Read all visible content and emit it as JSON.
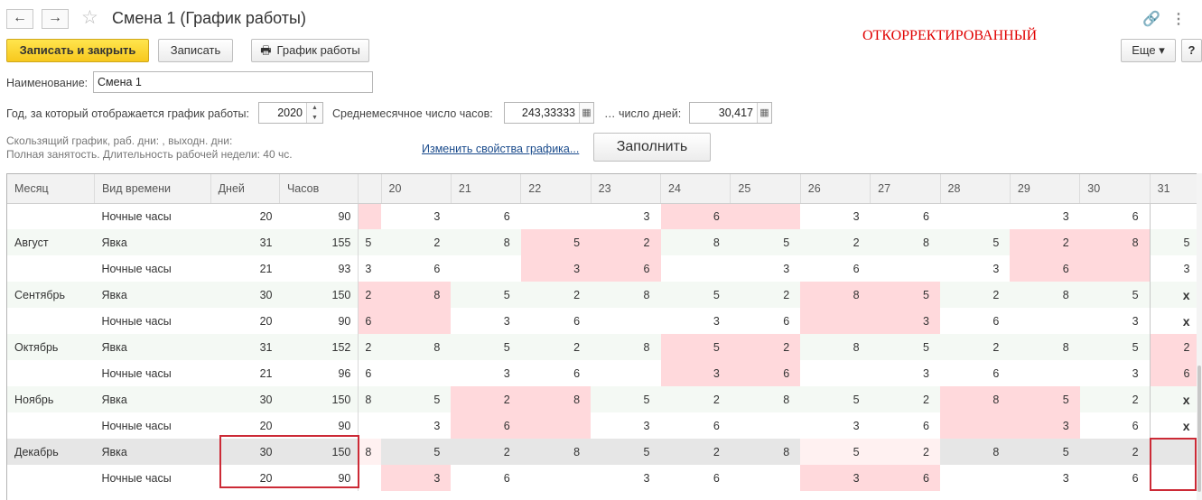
{
  "window": {
    "title": "Смена 1 (График работы)",
    "corrected_label": "ОТКОРРЕКТИРОВАННЫЙ",
    "back_icon": "←",
    "forward_icon": "→",
    "star_icon": "☆",
    "link_icon": "🔗",
    "more_icon": "⋮"
  },
  "toolbar": {
    "save_close_label": "Записать и закрыть",
    "save_label": "Записать",
    "schedule_icon": "🖶",
    "schedule_label": "График работы",
    "more_label": "Еще ▾",
    "help_label": "?"
  },
  "form": {
    "name_label": "Наименование:",
    "name_value": "Смена 1",
    "year_label": "Год, за который отображается график работы:",
    "year_value": "2020",
    "avg_hours_label": "Среднемесячное число часов:",
    "avg_hours_value": "243,33333",
    "days_label": "… число дней:",
    "days_value": "30,417",
    "calc_icon": "▦",
    "spin_up": "▲",
    "spin_down": "▼",
    "schedule_info_1": "Скользящий график, раб. дни: , выходн. дни:",
    "schedule_info_2": "Полная занятость. Длительность рабочей недели: 40 чс.",
    "change_props_link": "Изменить свойства графика...",
    "fill_button": "Заполнить"
  },
  "grid": {
    "headers": [
      "Месяц",
      "Вид времени",
      "Дней",
      "Часов",
      "",
      "20",
      "21",
      "22",
      "23",
      "24",
      "25",
      "26",
      "27",
      "28",
      "29",
      "30",
      "31"
    ],
    "rows": [
      {
        "month": "",
        "kind": "Ночные часы",
        "days": "20",
        "hours": "90",
        "cells": [
          "",
          "3",
          "6",
          "",
          "3",
          "6",
          "",
          "3",
          "6",
          "",
          "3",
          "6",
          ""
        ]
      },
      {
        "month": "Август",
        "kind": "Явка",
        "days": "31",
        "hours": "155",
        "cells": [
          "5",
          "2",
          "8",
          "5",
          "2",
          "8",
          "5",
          "2",
          "8",
          "5",
          "2",
          "8",
          "5"
        ]
      },
      {
        "month": "",
        "kind": "Ночные часы",
        "days": "21",
        "hours": "93",
        "cells": [
          "3",
          "6",
          "",
          "3",
          "6",
          "",
          "3",
          "6",
          "",
          "3",
          "6",
          "",
          "3"
        ]
      },
      {
        "month": "Сентябрь",
        "kind": "Явка",
        "days": "30",
        "hours": "150",
        "cells": [
          "2",
          "8",
          "5",
          "2",
          "8",
          "5",
          "2",
          "8",
          "5",
          "2",
          "8",
          "5",
          "x"
        ]
      },
      {
        "month": "",
        "kind": "Ночные часы",
        "days": "20",
        "hours": "90",
        "cells": [
          "6",
          "",
          "3",
          "6",
          "",
          "3",
          "6",
          "",
          "3",
          "6",
          "",
          "3",
          "x"
        ]
      },
      {
        "month": "Октябрь",
        "kind": "Явка",
        "days": "31",
        "hours": "152",
        "cells": [
          "2",
          "8",
          "5",
          "2",
          "8",
          "5",
          "2",
          "8",
          "5",
          "2",
          "8",
          "5",
          "2"
        ]
      },
      {
        "month": "",
        "kind": "Ночные часы",
        "days": "21",
        "hours": "96",
        "cells": [
          "6",
          "",
          "3",
          "6",
          "",
          "3",
          "6",
          "",
          "3",
          "6",
          "",
          "3",
          "6"
        ]
      },
      {
        "month": "Ноябрь",
        "kind": "Явка",
        "days": "30",
        "hours": "150",
        "cells": [
          "8",
          "5",
          "2",
          "8",
          "5",
          "2",
          "8",
          "5",
          "2",
          "8",
          "5",
          "2",
          "x"
        ]
      },
      {
        "month": "",
        "kind": "Ночные часы",
        "days": "20",
        "hours": "90",
        "cells": [
          "",
          "3",
          "6",
          "",
          "3",
          "6",
          "",
          "3",
          "6",
          "",
          "3",
          "6",
          "x"
        ]
      },
      {
        "month": "Декабрь",
        "kind": "Явка",
        "days": "30",
        "hours": "150",
        "cells": [
          "8",
          "5",
          "2",
          "8",
          "5",
          "2",
          "8",
          "5",
          "2",
          "8",
          "5",
          "2",
          ""
        ]
      },
      {
        "month": "",
        "kind": "Ночные часы",
        "days": "20",
        "hours": "90",
        "cells": [
          "",
          "3",
          "6",
          "",
          "3",
          "6",
          "",
          "3",
          "6",
          "",
          "3",
          "6",
          ""
        ]
      }
    ]
  }
}
